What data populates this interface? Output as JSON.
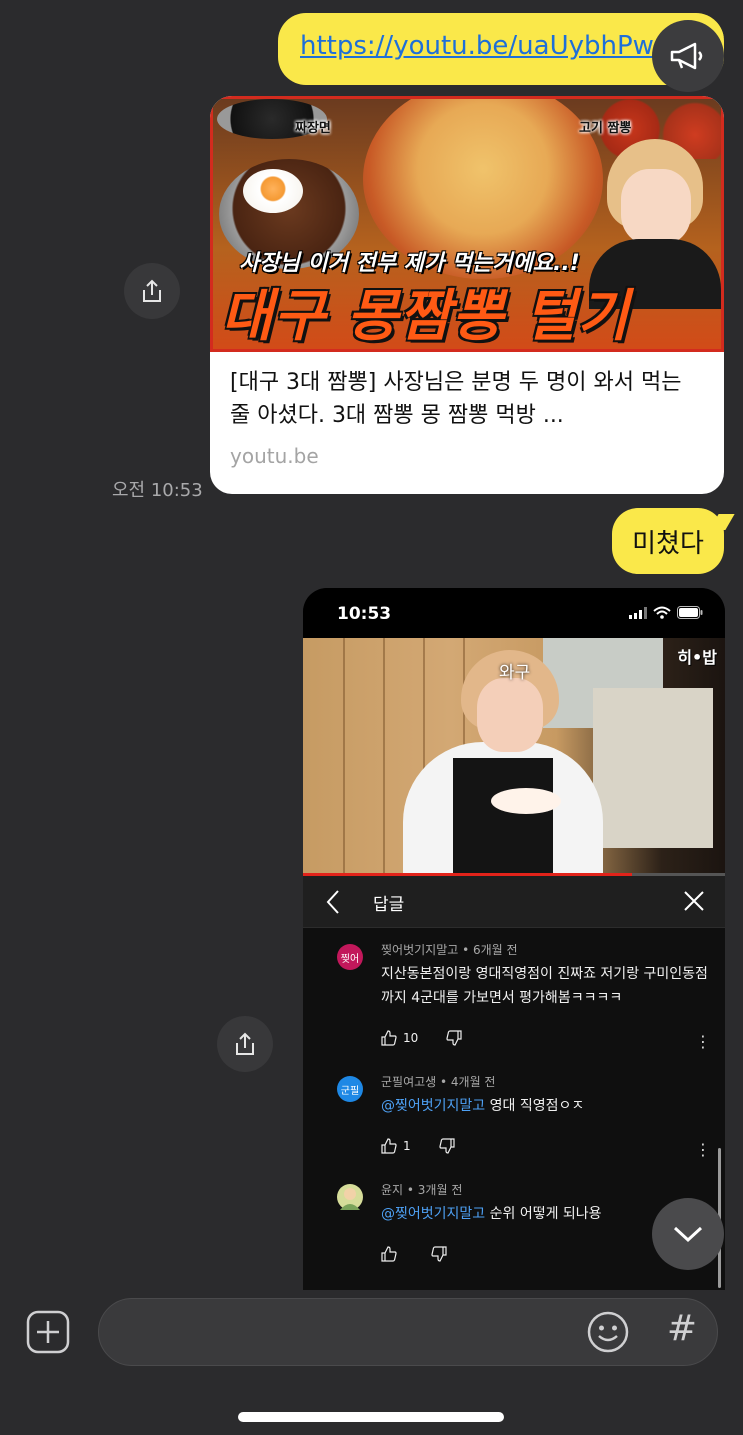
{
  "chat": {
    "link_message": "https://youtu.be/uaUybhPw",
    "link_card": {
      "thumb_tag_left": "짜장면",
      "thumb_tag_right": "고기 짬뽕",
      "thumb_subtitle": "사장님 이거 전부 제가 먹는거에요..!",
      "thumb_headline": "대구 몽짬뽕 털기",
      "title": "[대구 3대 짬뽕] 사장님은 분명 두 명이 와서 먹는 줄 아셨다. 3대 짬뽕 몽 짬뽕 먹방 ...",
      "domain": "youtu.be"
    },
    "timestamp": "오전 10:53",
    "text_message": "미쳤다"
  },
  "screenshot": {
    "status_time": "10:53",
    "video_name_tag": "와구",
    "video_logo": "히•밥",
    "video_progress": 0.78,
    "reply_title": "답글",
    "comments": [
      {
        "avatar_text": "찢어",
        "avatar_color": "#c2185b",
        "meta": "찢어벗기지말고 • 6개월 전",
        "mention": "",
        "text": "지산동본점이랑 영대직영점이 진짜죠 저기랑 구미인동점까지 4군대를 가보면서 평가해봄ㅋㅋㅋㅋ",
        "likes": "10"
      },
      {
        "avatar_text": "군필",
        "avatar_color": "#1e88e5",
        "meta": "군필여고생 • 4개월 전",
        "mention": "@찢어벗기지말고",
        "text": "영대 직영점ㅇㅈ",
        "likes": "1"
      },
      {
        "avatar_text": "",
        "avatar_color": "#c9d48a",
        "meta": "윤지 • 3개월 전",
        "mention": "@찢어벗기지말고",
        "text": "순위 어떻게 되나용",
        "likes": ""
      }
    ]
  },
  "input": {
    "hash_symbol": "#"
  },
  "icons": [
    "megaphone-icon",
    "share-icon",
    "chevron-left-icon",
    "close-icon",
    "thumbs-up-icon",
    "thumbs-down-icon",
    "more-vert-icon",
    "chevron-down-icon",
    "plus-icon",
    "emoji-icon"
  ]
}
